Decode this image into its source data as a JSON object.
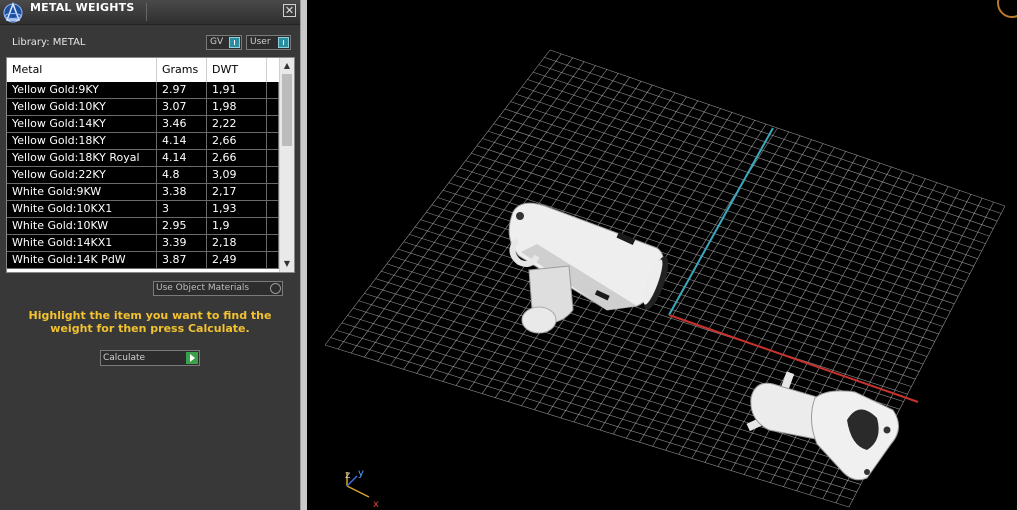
{
  "panel": {
    "title": "METAL WEIGHTS",
    "close_glyph": "✕",
    "library_label": "Library: METAL",
    "toggles": [
      {
        "label": "GV"
      },
      {
        "label": "User"
      }
    ],
    "table": {
      "headers": [
        "Metal",
        "Grams",
        "DWT"
      ],
      "rows": [
        {
          "metal": "Yellow Gold:9KY",
          "grams": "2.97",
          "dwt": "1,91"
        },
        {
          "metal": "Yellow Gold:10KY",
          "grams": "3.07",
          "dwt": "1,98"
        },
        {
          "metal": "Yellow Gold:14KY",
          "grams": "3.46",
          "dwt": "2,22"
        },
        {
          "metal": "Yellow Gold:18KY",
          "grams": "4.14",
          "dwt": "2,66"
        },
        {
          "metal": "Yellow Gold:18KY Royal",
          "grams": "4.14",
          "dwt": "2,66"
        },
        {
          "metal": "Yellow Gold:22KY",
          "grams": "4.8",
          "dwt": "3,09"
        },
        {
          "metal": "White Gold:9KW",
          "grams": "3.38",
          "dwt": "2,17"
        },
        {
          "metal": "White Gold:10KX1",
          "grams": "3",
          "dwt": "1,93"
        },
        {
          "metal": "White Gold:10KW",
          "grams": "2.95",
          "dwt": "1,9"
        },
        {
          "metal": "White Gold:14KX1",
          "grams": "3.39",
          "dwt": "2,18"
        },
        {
          "metal": "White Gold:14K PdW",
          "grams": "3.87",
          "dwt": "2,49"
        }
      ]
    },
    "use_object_materials_label": "Use Object Materials",
    "hint_text": "Highlight the item you want to find the weight for then press Calculate.",
    "calculate_label": "Calculate"
  },
  "viewport": {
    "axis_labels": {
      "x": "x",
      "y": "y",
      "z": "z"
    },
    "colors": {
      "grid": "#bfbfbf",
      "x_axis": "#c8322d",
      "y_axis": "#3aa8c0",
      "accent_yellow": "#f2c230",
      "object": "#f2f2f2"
    }
  }
}
